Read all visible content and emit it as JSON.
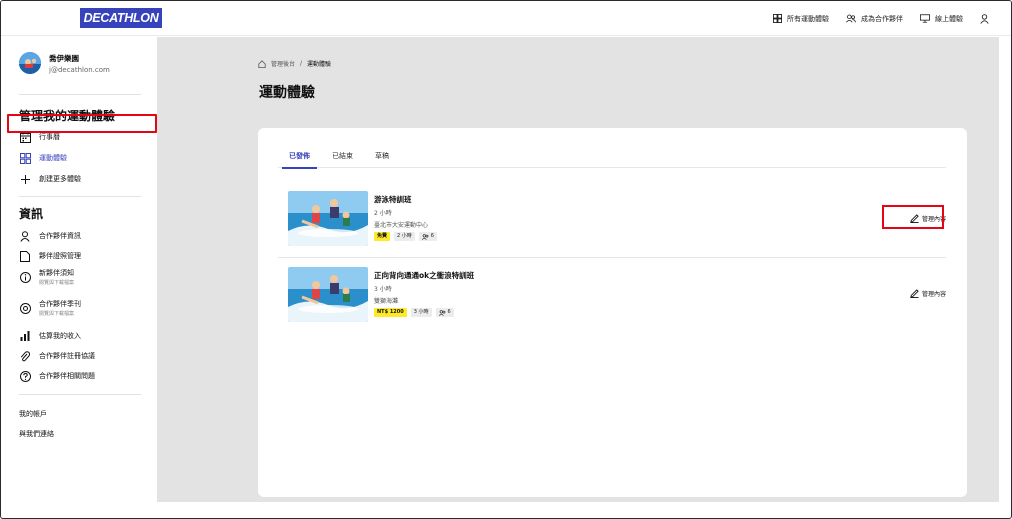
{
  "header": {
    "logo": "DECATHLON",
    "nav": [
      {
        "label": "所有運動體驗",
        "icon": "grid-icon"
      },
      {
        "label": "成為合作夥伴",
        "icon": "users-icon"
      },
      {
        "label": "線上體驗",
        "icon": "monitor-icon"
      }
    ],
    "account_icon": "user-icon"
  },
  "sidebar": {
    "profile": {
      "name": "喬伊樂園",
      "email": "j@decathlon.com"
    },
    "section1_title": "管理我的運動體驗",
    "section1_items": [
      {
        "label": "行事曆",
        "icon": "calendar-icon"
      },
      {
        "label": "運動體驗",
        "icon": "grid-icon"
      },
      {
        "label": "創建更多體驗",
        "icon": "plus-icon"
      }
    ],
    "section2_title": "資訊",
    "section2_items": [
      {
        "label": "合作夥伴資訊",
        "sub": "",
        "icon": "user-icon"
      },
      {
        "label": "夥伴證照管理",
        "sub": "",
        "icon": "document-icon"
      },
      {
        "label": "新夥伴須知",
        "sub": "閱覽與下載檔案",
        "icon": "info-icon"
      },
      {
        "label": "合作夥伴季刊",
        "sub": "閱覽與下載檔案",
        "icon": "eye-icon"
      },
      {
        "label": "估算我的收入",
        "sub": "",
        "icon": "bar-chart-icon"
      },
      {
        "label": "合作夥伴註冊協議",
        "sub": "",
        "icon": "paperclip-icon"
      },
      {
        "label": "合作夥伴相關問題",
        "sub": "",
        "icon": "question-icon"
      }
    ],
    "account": "我的帳戶",
    "contact": "與我們連絡"
  },
  "main": {
    "breadcrumb": {
      "home": "管理後台",
      "separator": "/",
      "current": "運動體驗"
    },
    "title": "運動體驗",
    "tabs": [
      "已發佈",
      "已結束",
      "草稿"
    ],
    "selected_tab": "已發佈",
    "experiences": [
      {
        "title": "游泳特訓班",
        "duration": "2 小時",
        "location": "臺北市大安運動中心",
        "price": "免費",
        "length": "2 小時",
        "capacity": "6",
        "manage_label": "管理內容"
      },
      {
        "title": "正向背向通通ok之衝浪特訓班",
        "duration": "3 小時",
        "location": "雙獅海灘",
        "price": "NT$ 1200",
        "length": "3 小時",
        "capacity": "6",
        "manage_label": "管理內容"
      }
    ]
  },
  "colors": {
    "brand": "#3643ba",
    "highlight": "#e30613",
    "price_chip": "#ffea28",
    "background": "#e3e3e3"
  }
}
